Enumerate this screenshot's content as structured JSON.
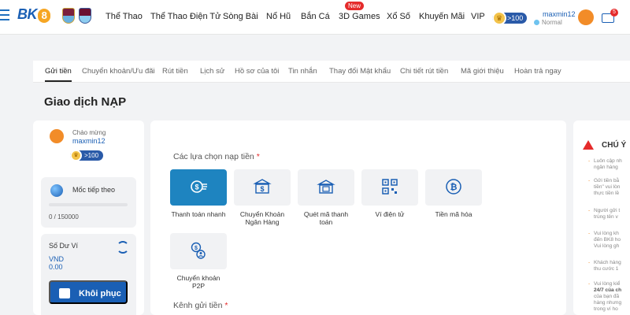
{
  "header": {
    "logo": "BK",
    "logo_digit": "8",
    "nav": [
      {
        "label": "Thể Thao",
        "x": 0
      },
      {
        "label": "Thể Thao Điện Tử",
        "x": 0
      },
      {
        "label": "Sòng Bài",
        "x": 0
      },
      {
        "label": "Nổ Hũ",
        "x": 0
      },
      {
        "label": "Bắn Cá",
        "x": 0
      },
      {
        "label": "3D Games",
        "x": 0
      },
      {
        "label": "Xổ Số",
        "x": 0
      },
      {
        "label": "Khuyến Mãi",
        "x": 0
      },
      {
        "label": "VIP",
        "x": 0
      }
    ],
    "new_badge": "New",
    "vip_chip": ">100",
    "username": "maxmin12",
    "user_level": "Normal",
    "mail_count": "5"
  },
  "tabs": [
    "Gửi tiền",
    "Chuyển khoản/Ưu đãi",
    "Rút tiền",
    "Lịch sử",
    "Hồ sơ của tôi",
    "Tin nhắn",
    "Thay đổi Mật khẩu",
    "Chi tiết rút tiền",
    "Mã giới thiệu",
    "Hoàn trả ngay"
  ],
  "page_title": "Giao dịch NẠP",
  "sidebar": {
    "welcome_label": "Chào mừng",
    "username": "maxmin12",
    "vip_chip": ">100",
    "milestone_label": "Mốc tiếp theo",
    "milestone_value": "0 / 150000",
    "milestone_progress": 0,
    "wallet_label": "Số Dư Ví",
    "wallet_currency": "VND",
    "wallet_amount": "0.00",
    "restore_button": "Khôi phục"
  },
  "deposit": {
    "options_title": "Các lựa chọn nạp tiền",
    "channel_title": "Kênh gửi tiền",
    "required_mark": "*",
    "methods": [
      {
        "label": "Thanh toán nhanh",
        "icon": "fast-pay-icon",
        "active": true
      },
      {
        "label": "Chuyển Khoản Ngân Hàng",
        "icon": "bank-transfer-icon",
        "active": false
      },
      {
        "label": "Quét mã thanh toán",
        "icon": "scan-pay-icon",
        "active": false
      },
      {
        "label": "Ví điện tử",
        "icon": "qr-wallet-icon",
        "active": false
      },
      {
        "label": "Tiền mã hóa",
        "icon": "bitcoin-icon",
        "active": false
      },
      {
        "label": "Chuyển khoản P2P",
        "icon": "p2p-transfer-icon",
        "active": false
      }
    ]
  },
  "notice": {
    "title": "CHÚ Ý",
    "items": [
      {
        "lines": [
          "Luôn cập nh",
          "ngân hàng"
        ]
      },
      {
        "lines": [
          "Gửi tiền bằ",
          "tiền\" vui lòn",
          "thực tiền lề"
        ]
      },
      {
        "lines": [
          "Người gửi t",
          "trùng tên v"
        ]
      },
      {
        "lines": [
          "Vui lòng kh",
          "đến BK8 ho",
          "Vui lòng gh"
        ]
      },
      {
        "lines": [
          "Khách hàng",
          "thu cước 1"
        ]
      },
      {
        "lines": [
          "Vui lòng kiể",
          "24/7 của ch",
          "của bạn đã",
          "hàng nhưng",
          "trong ví ho"
        ]
      }
    ]
  },
  "colors": {
    "brand": "#1a5fb4",
    "accent": "#f28c28",
    "active_method": "#1e84c0",
    "alert": "#e52b2b"
  }
}
